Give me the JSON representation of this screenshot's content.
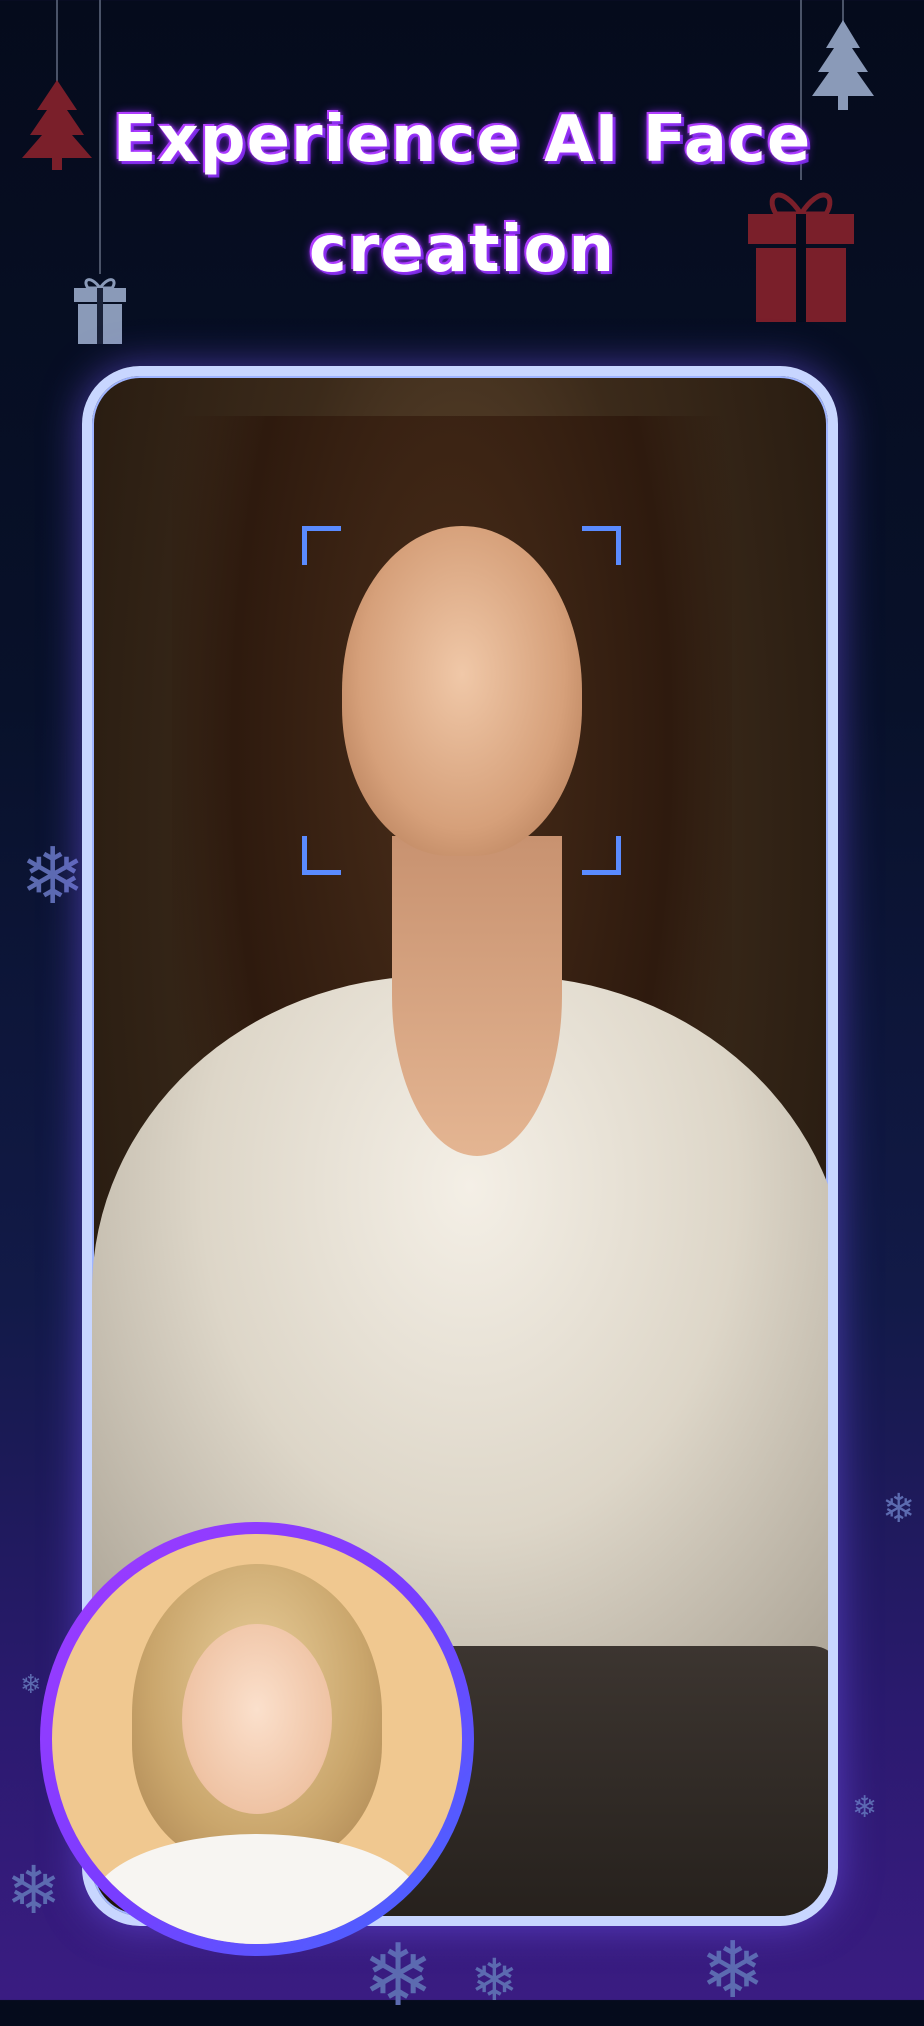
{
  "header": {
    "title_line1": "Experience AI Face",
    "title_line2": "creation"
  },
  "colors": {
    "title_glow": "#8e2bff",
    "card_border": "#c8d6ff",
    "face_frame": "#5a8bff",
    "inset_ring_start": "#a23bff",
    "inset_ring_end": "#3f6bff"
  },
  "decorations": {
    "icons": [
      "christmas-tree-icon",
      "gift-box-icon",
      "snowflake-icon"
    ]
  },
  "images": {
    "main": "ai-generated-portrait",
    "source": "source-selfie-photo"
  }
}
